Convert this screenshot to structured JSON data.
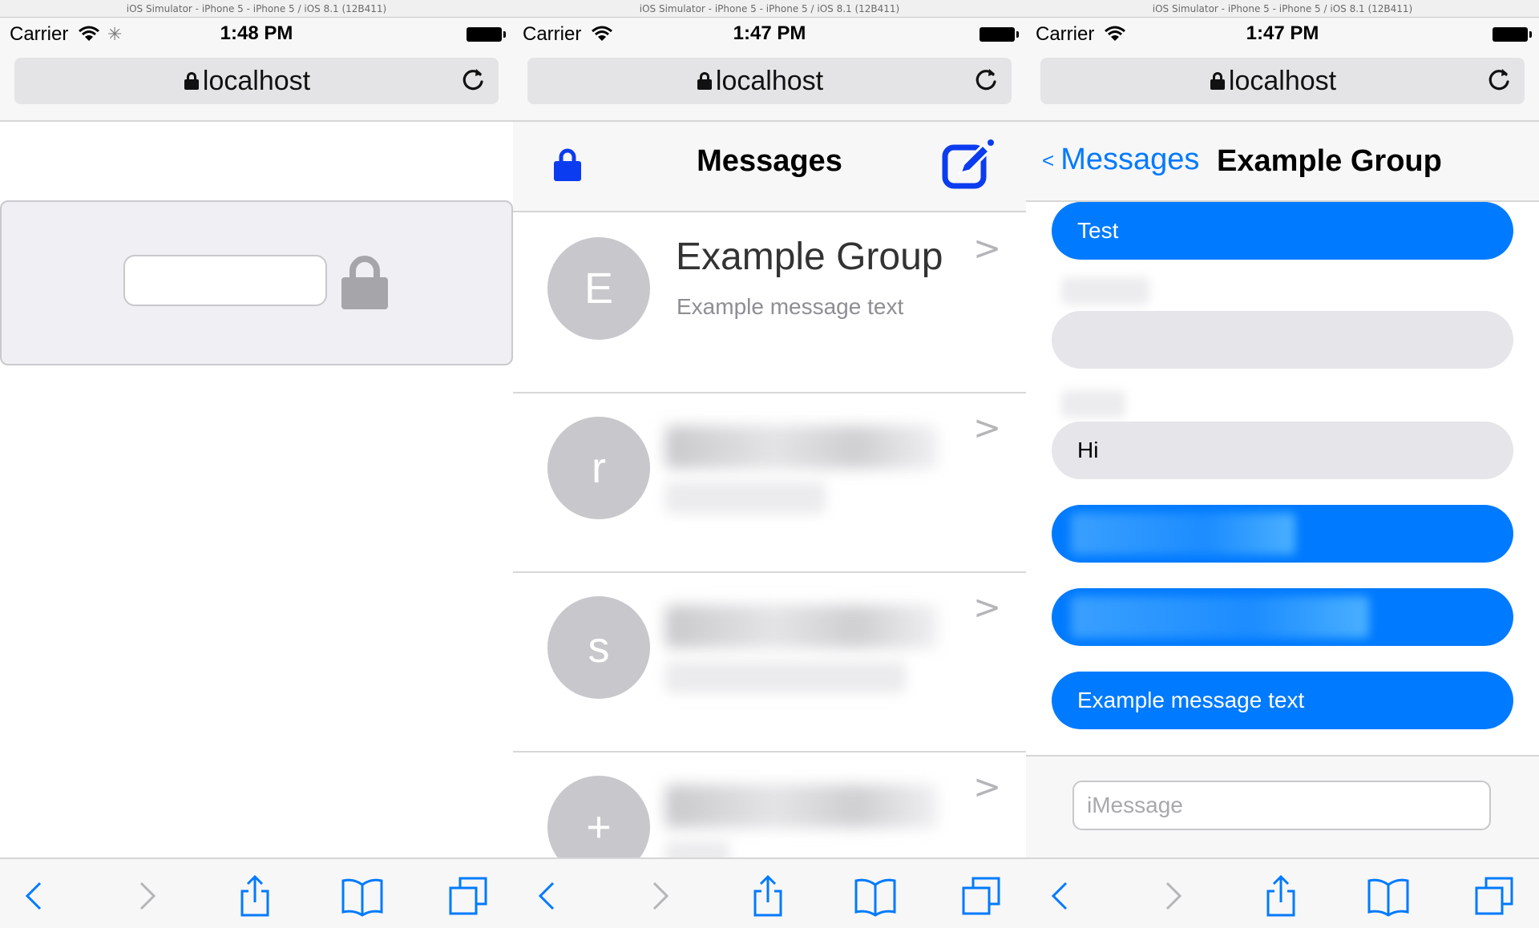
{
  "simulator": {
    "title": "iOS Simulator - iPhone 5 - iPhone 5 / iOS 8.1 (12B411)"
  },
  "colors": {
    "ios_blue": "#007aff",
    "bubble_gray": "#e5e5ea",
    "avatar_gray": "#c7c7cc",
    "compose_blue": "#0c3cf0"
  },
  "screens": [
    {
      "status": {
        "carrier": "Carrier",
        "time": "1:48 PM"
      },
      "url": "localhost",
      "lock_screen": {
        "password_value": ""
      }
    },
    {
      "status": {
        "carrier": "Carrier",
        "time": "1:47 PM"
      },
      "url": "localhost",
      "nav_title": "Messages",
      "conversations": [
        {
          "avatar_letter": "E",
          "name": "Example Group",
          "preview": "Example message text",
          "chevron": ">"
        },
        {
          "avatar_letter": "r",
          "name": "",
          "preview": "",
          "chevron": ">"
        },
        {
          "avatar_letter": "s",
          "name": "",
          "preview": "",
          "chevron": ">"
        },
        {
          "avatar_letter": "+",
          "name": "",
          "preview": "",
          "chevron": ">"
        }
      ]
    },
    {
      "status": {
        "carrier": "Carrier",
        "time": "1:47 PM"
      },
      "url": "localhost",
      "back_label": "Messages",
      "back_arrow": "<",
      "chat_title": "Example Group",
      "messages": [
        {
          "direction": "out",
          "text": "Test"
        },
        {
          "direction": "in",
          "text": ""
        },
        {
          "direction": "in",
          "text": "Hi"
        },
        {
          "direction": "out",
          "text": ""
        },
        {
          "direction": "out",
          "text": ""
        },
        {
          "direction": "out",
          "text": "Example message text"
        }
      ],
      "input_placeholder": "iMessage"
    }
  ],
  "toolbar": {
    "icons": [
      "back-icon",
      "forward-icon",
      "share-icon",
      "bookmarks-icon",
      "tabs-icon"
    ]
  }
}
